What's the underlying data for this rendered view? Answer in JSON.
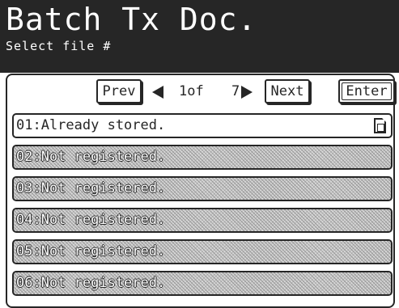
{
  "header": {
    "title": "Batch Tx Doc.",
    "subtitle": "Select file #"
  },
  "nav": {
    "prev_label": "Prev",
    "next_label": "Next",
    "enter_label": "Enter",
    "page_current": "1of",
    "page_total": "7",
    "left_arrow_icon": "triangle-left-icon",
    "right_arrow_icon": "triangle-right-icon"
  },
  "files": [
    {
      "label": "01:Already stored.",
      "status": "stored",
      "icon": "document-icon"
    },
    {
      "label": "02:Not registered.",
      "status": "empty"
    },
    {
      "label": "03:Not registered.",
      "status": "empty"
    },
    {
      "label": "04:Not registered.",
      "status": "empty"
    },
    {
      "label": "05:Not registered.",
      "status": "empty"
    },
    {
      "label": "06:Not registered.",
      "status": "empty"
    }
  ],
  "colors": {
    "header_bg": "#262626",
    "header_text": "#ffffff",
    "empty_row_fill": "#d8d8d8",
    "outline": "#262626"
  }
}
